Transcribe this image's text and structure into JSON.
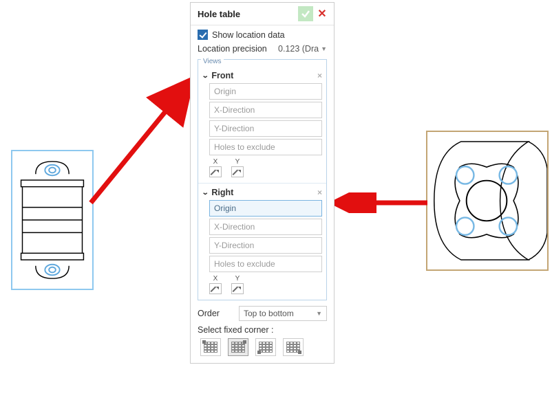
{
  "dialog": {
    "title": "Hole table",
    "show_location_label": "Show location data",
    "precision_label": "Location precision",
    "precision_value": "0.123 (Dra",
    "views_label": "Views",
    "views": [
      {
        "name": "Front",
        "fields": {
          "origin": "Origin",
          "xdir": "X-Direction",
          "ydir": "Y-Direction",
          "exclude": "Holes to exclude"
        },
        "xy": {
          "x": "X",
          "y": "Y"
        },
        "active_field": null
      },
      {
        "name": "Right",
        "fields": {
          "origin": "Origin",
          "xdir": "X-Direction",
          "ydir": "Y-Direction",
          "exclude": "Holes to exclude"
        },
        "xy": {
          "x": "X",
          "y": "Y"
        },
        "active_field": "origin"
      }
    ],
    "order_label": "Order",
    "order_value": "Top to bottom",
    "fixed_corner_label": "Select fixed corner :"
  }
}
